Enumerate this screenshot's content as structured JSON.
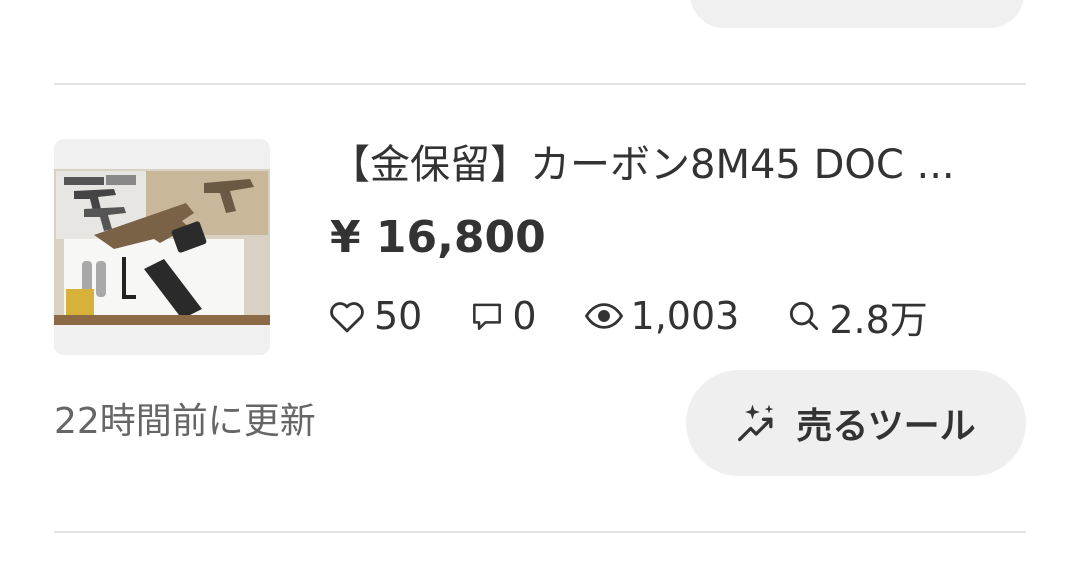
{
  "listing": {
    "title": "【金保留】カーボン8M45 DOC ...",
    "price": "¥ 16,800",
    "stats": {
      "likes": "50",
      "comments": "0",
      "views": "1,003",
      "searches": "2.8万"
    },
    "updated": "22時間前に更新",
    "sell_tool_label": "売るツール"
  },
  "icons": {
    "likes": "heart-icon",
    "comments": "comment-icon",
    "views": "eye-icon",
    "searches": "search-icon",
    "sell_tool": "sparkle-trend-icon"
  },
  "colors": {
    "text": "#333333",
    "subtext": "#666666",
    "pill_background": "#efefef",
    "divider": "#e3e3e3"
  }
}
